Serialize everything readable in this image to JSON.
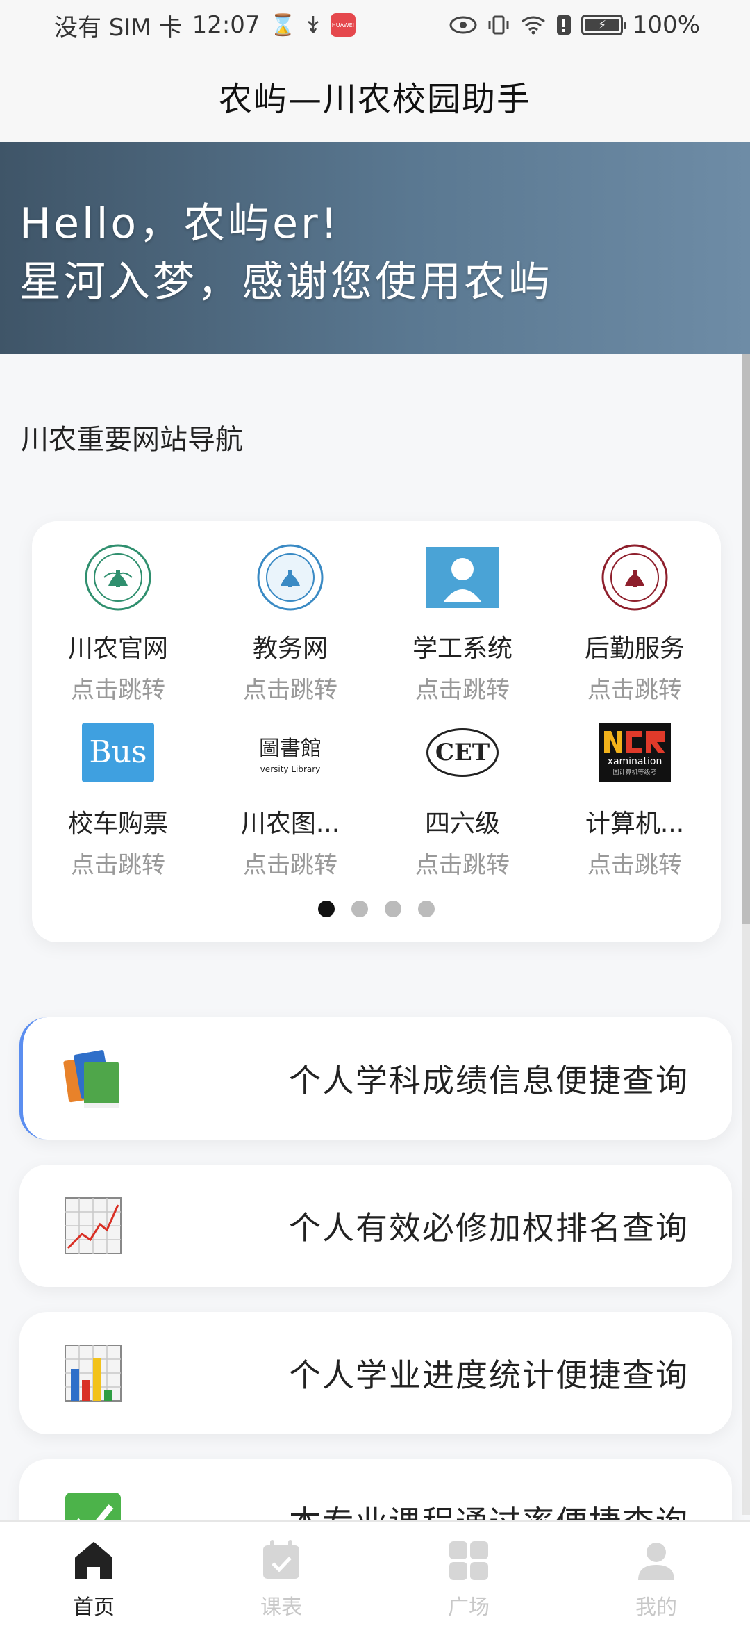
{
  "status_bar": {
    "sim": "没有 SIM 卡",
    "time": "12:07",
    "battery": "100%",
    "app_badge": "HUAWEI"
  },
  "app_bar": {
    "title": "农屿—川农校园助手"
  },
  "banner": {
    "line1": "Hello，农屿er!",
    "line2": "星河入梦，感谢您使用农屿"
  },
  "nav_section": {
    "title": "川农重要网站导航",
    "items": [
      {
        "label": "川农官网",
        "sub": "点击跳转",
        "logo": "university-seal-green"
      },
      {
        "label": "教务网",
        "sub": "点击跳转",
        "logo": "university-seal-blue"
      },
      {
        "label": "学工系统",
        "sub": "点击跳转",
        "logo": "person-icon"
      },
      {
        "label": "后勤服务",
        "sub": "点击跳转",
        "logo": "university-seal-red"
      },
      {
        "label": "校车购票",
        "sub": "点击跳转",
        "logo": "bus-logo",
        "logo_text": "Bus"
      },
      {
        "label": "川农图...",
        "sub": "点击跳转",
        "logo": "library-logo",
        "logo_text": "圖書館",
        "logo_sub": "versity Library"
      },
      {
        "label": "四六级",
        "sub": "点击跳转",
        "logo": "cet-logo",
        "logo_text": "CET"
      },
      {
        "label": "计算机...",
        "sub": "点击跳转",
        "logo": "ncre-logo",
        "logo_text": "xamination",
        "logo_sub": "国计算机等级考"
      }
    ],
    "page_count": 4,
    "active_page": 1
  },
  "query_cards": [
    {
      "label": "个人学科成绩信息便捷查询",
      "icon": "books-icon"
    },
    {
      "label": "个人有效必修加权排名查询",
      "icon": "line-chart-icon"
    },
    {
      "label": "个人学业进度统计便捷查询",
      "icon": "bar-chart-icon"
    },
    {
      "label": "本专业课程通过率便捷查询",
      "icon": "check-mark-icon"
    }
  ],
  "bottom_nav": [
    {
      "label": "首页",
      "icon": "home-icon",
      "active": true
    },
    {
      "label": "课表",
      "icon": "calendar-icon",
      "active": false
    },
    {
      "label": "广场",
      "icon": "grid-icon",
      "active": false
    },
    {
      "label": "我的",
      "icon": "profile-icon",
      "active": false
    }
  ],
  "colors": {
    "banner_start": "#3f5568",
    "banner_end": "#6e8ca6",
    "active_indicator": "#5b8ef0",
    "inactive_nav": "#c8c8c8"
  }
}
